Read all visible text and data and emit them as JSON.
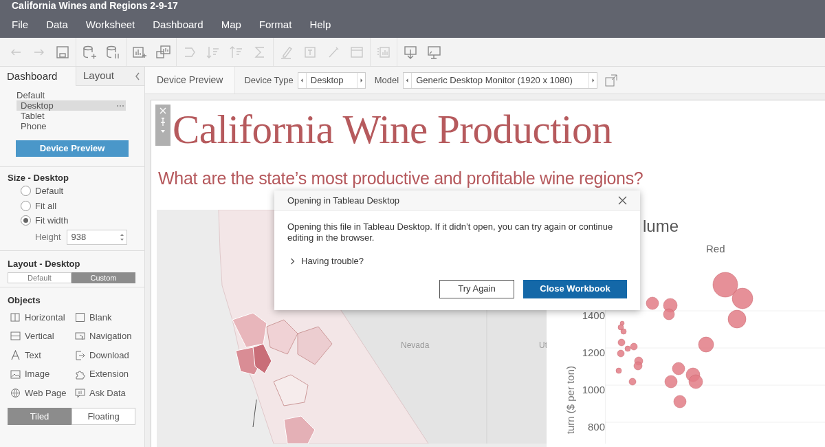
{
  "window": {
    "title": "California Wines and Regions 2-9-17"
  },
  "menu": [
    "File",
    "Data",
    "Worksheet",
    "Dashboard",
    "Map",
    "Format",
    "Help"
  ],
  "sidebar": {
    "tabs": [
      {
        "label": "Dashboard",
        "selected": true
      },
      {
        "label": "Layout",
        "selected": false
      }
    ],
    "devices": [
      {
        "label": "Default",
        "selected": false,
        "children": [
          {
            "label": "Desktop",
            "selected": true
          },
          {
            "label": "Tablet",
            "selected": false
          },
          {
            "label": "Phone",
            "selected": false
          }
        ]
      }
    ],
    "device_preview_button": "Device Preview",
    "size": {
      "title": "Size - Desktop",
      "options": [
        {
          "label": "Default",
          "selected": false
        },
        {
          "label": "Fit all",
          "selected": false
        },
        {
          "label": "Fit width",
          "selected": true
        }
      ],
      "height": {
        "label": "Height",
        "value": "938"
      }
    },
    "layout": {
      "title": "Layout - Desktop",
      "segments": [
        {
          "label": "Default",
          "selected": false
        },
        {
          "label": "Custom",
          "selected": true
        }
      ]
    },
    "objects": {
      "title": "Objects",
      "items": [
        {
          "label": "Horizontal",
          "kind": "horizontal"
        },
        {
          "label": "Blank",
          "kind": "blank"
        },
        {
          "label": "Vertical",
          "kind": "vertical"
        },
        {
          "label": "Navigation",
          "kind": "navigation"
        },
        {
          "label": "Text",
          "kind": "text"
        },
        {
          "label": "Download",
          "kind": "download"
        },
        {
          "label": "Image",
          "kind": "image"
        },
        {
          "label": "Extension",
          "kind": "extension"
        },
        {
          "label": "Web Page",
          "kind": "webpage"
        },
        {
          "label": "Ask Data",
          "kind": "askdata"
        }
      ]
    },
    "mode": [
      {
        "label": "Tiled",
        "selected": true
      },
      {
        "label": "Floating",
        "selected": false
      }
    ]
  },
  "preview_bar": {
    "tab": "Device Preview",
    "device_type": {
      "label": "Device Type",
      "value": "Desktop"
    },
    "model": {
      "label": "Model",
      "value": "Generic Desktop Monitor (1920 x 1080)"
    }
  },
  "dashboard": {
    "title": "California Wine Production",
    "subtitle": "What are the state’s most productive and profitable wine regions?",
    "map": {
      "labels": [
        "Nevada",
        "Ut"
      ]
    },
    "chart": {
      "title": "lume",
      "panel": "Red",
      "y_ticks": [
        "1400",
        "1200",
        "1000",
        "800"
      ],
      "y_axis_title": "turn ($ per ton)"
    }
  },
  "dialog": {
    "title": "Opening in Tableau Desktop",
    "message": "Opening this file in Tableau Desktop. If it didn’t open, you can try again or continue editing in the browser.",
    "disclosure": {
      "label": "Having trouble?",
      "expanded": false
    },
    "buttons": [
      {
        "label": "Try Again",
        "kind": "secondary"
      },
      {
        "label": "Close Workbook",
        "kind": "primary"
      }
    ]
  }
}
